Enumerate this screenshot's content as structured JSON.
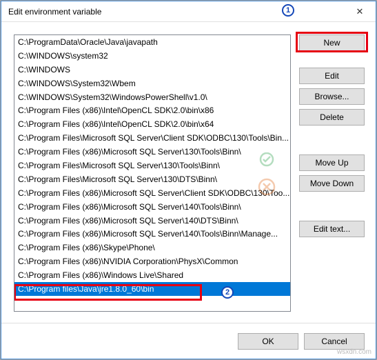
{
  "dialog": {
    "title": "Edit environment variable"
  },
  "list": {
    "items": [
      "C:\\ProgramData\\Oracle\\Java\\javapath",
      "C:\\WINDOWS\\system32",
      "C:\\WINDOWS",
      "C:\\WINDOWS\\System32\\Wbem",
      "C:\\WINDOWS\\System32\\WindowsPowerShell\\v1.0\\",
      "C:\\Program Files (x86)\\Intel\\OpenCL SDK\\2.0\\bin\\x86",
      "C:\\Program Files (x86)\\Intel\\OpenCL SDK\\2.0\\bin\\x64",
      "C:\\Program Files\\Microsoft SQL Server\\Client SDK\\ODBC\\130\\Tools\\Bin...",
      "C:\\Program Files (x86)\\Microsoft SQL Server\\130\\Tools\\Binn\\",
      "C:\\Program Files\\Microsoft SQL Server\\130\\Tools\\Binn\\",
      "C:\\Program Files\\Microsoft SQL Server\\130\\DTS\\Binn\\",
      "C:\\Program Files (x86)\\Microsoft SQL Server\\Client SDK\\ODBC\\130\\Too...",
      "C:\\Program Files (x86)\\Microsoft SQL Server\\140\\Tools\\Binn\\",
      "C:\\Program Files (x86)\\Microsoft SQL Server\\140\\DTS\\Binn\\",
      "C:\\Program Files (x86)\\Microsoft SQL Server\\140\\Tools\\Binn\\Manage...",
      "C:\\Program Files (x86)\\Skype\\Phone\\",
      "C:\\Program Files (x86)\\NVIDIA Corporation\\PhysX\\Common",
      "C:\\Program Files (x86)\\Windows Live\\Shared",
      "C:\\Program files\\Java\\jre1.8.0_60\\bin"
    ],
    "selected_index": 18
  },
  "buttons": {
    "new": "New",
    "edit": "Edit",
    "browse": "Browse...",
    "delete": "Delete",
    "move_up": "Move Up",
    "move_down": "Move Down",
    "edit_text": "Edit text...",
    "ok": "OK",
    "cancel": "Cancel"
  },
  "annotations": {
    "badge1": "1",
    "badge2": "2",
    "watermark": "wsxdn.com"
  }
}
